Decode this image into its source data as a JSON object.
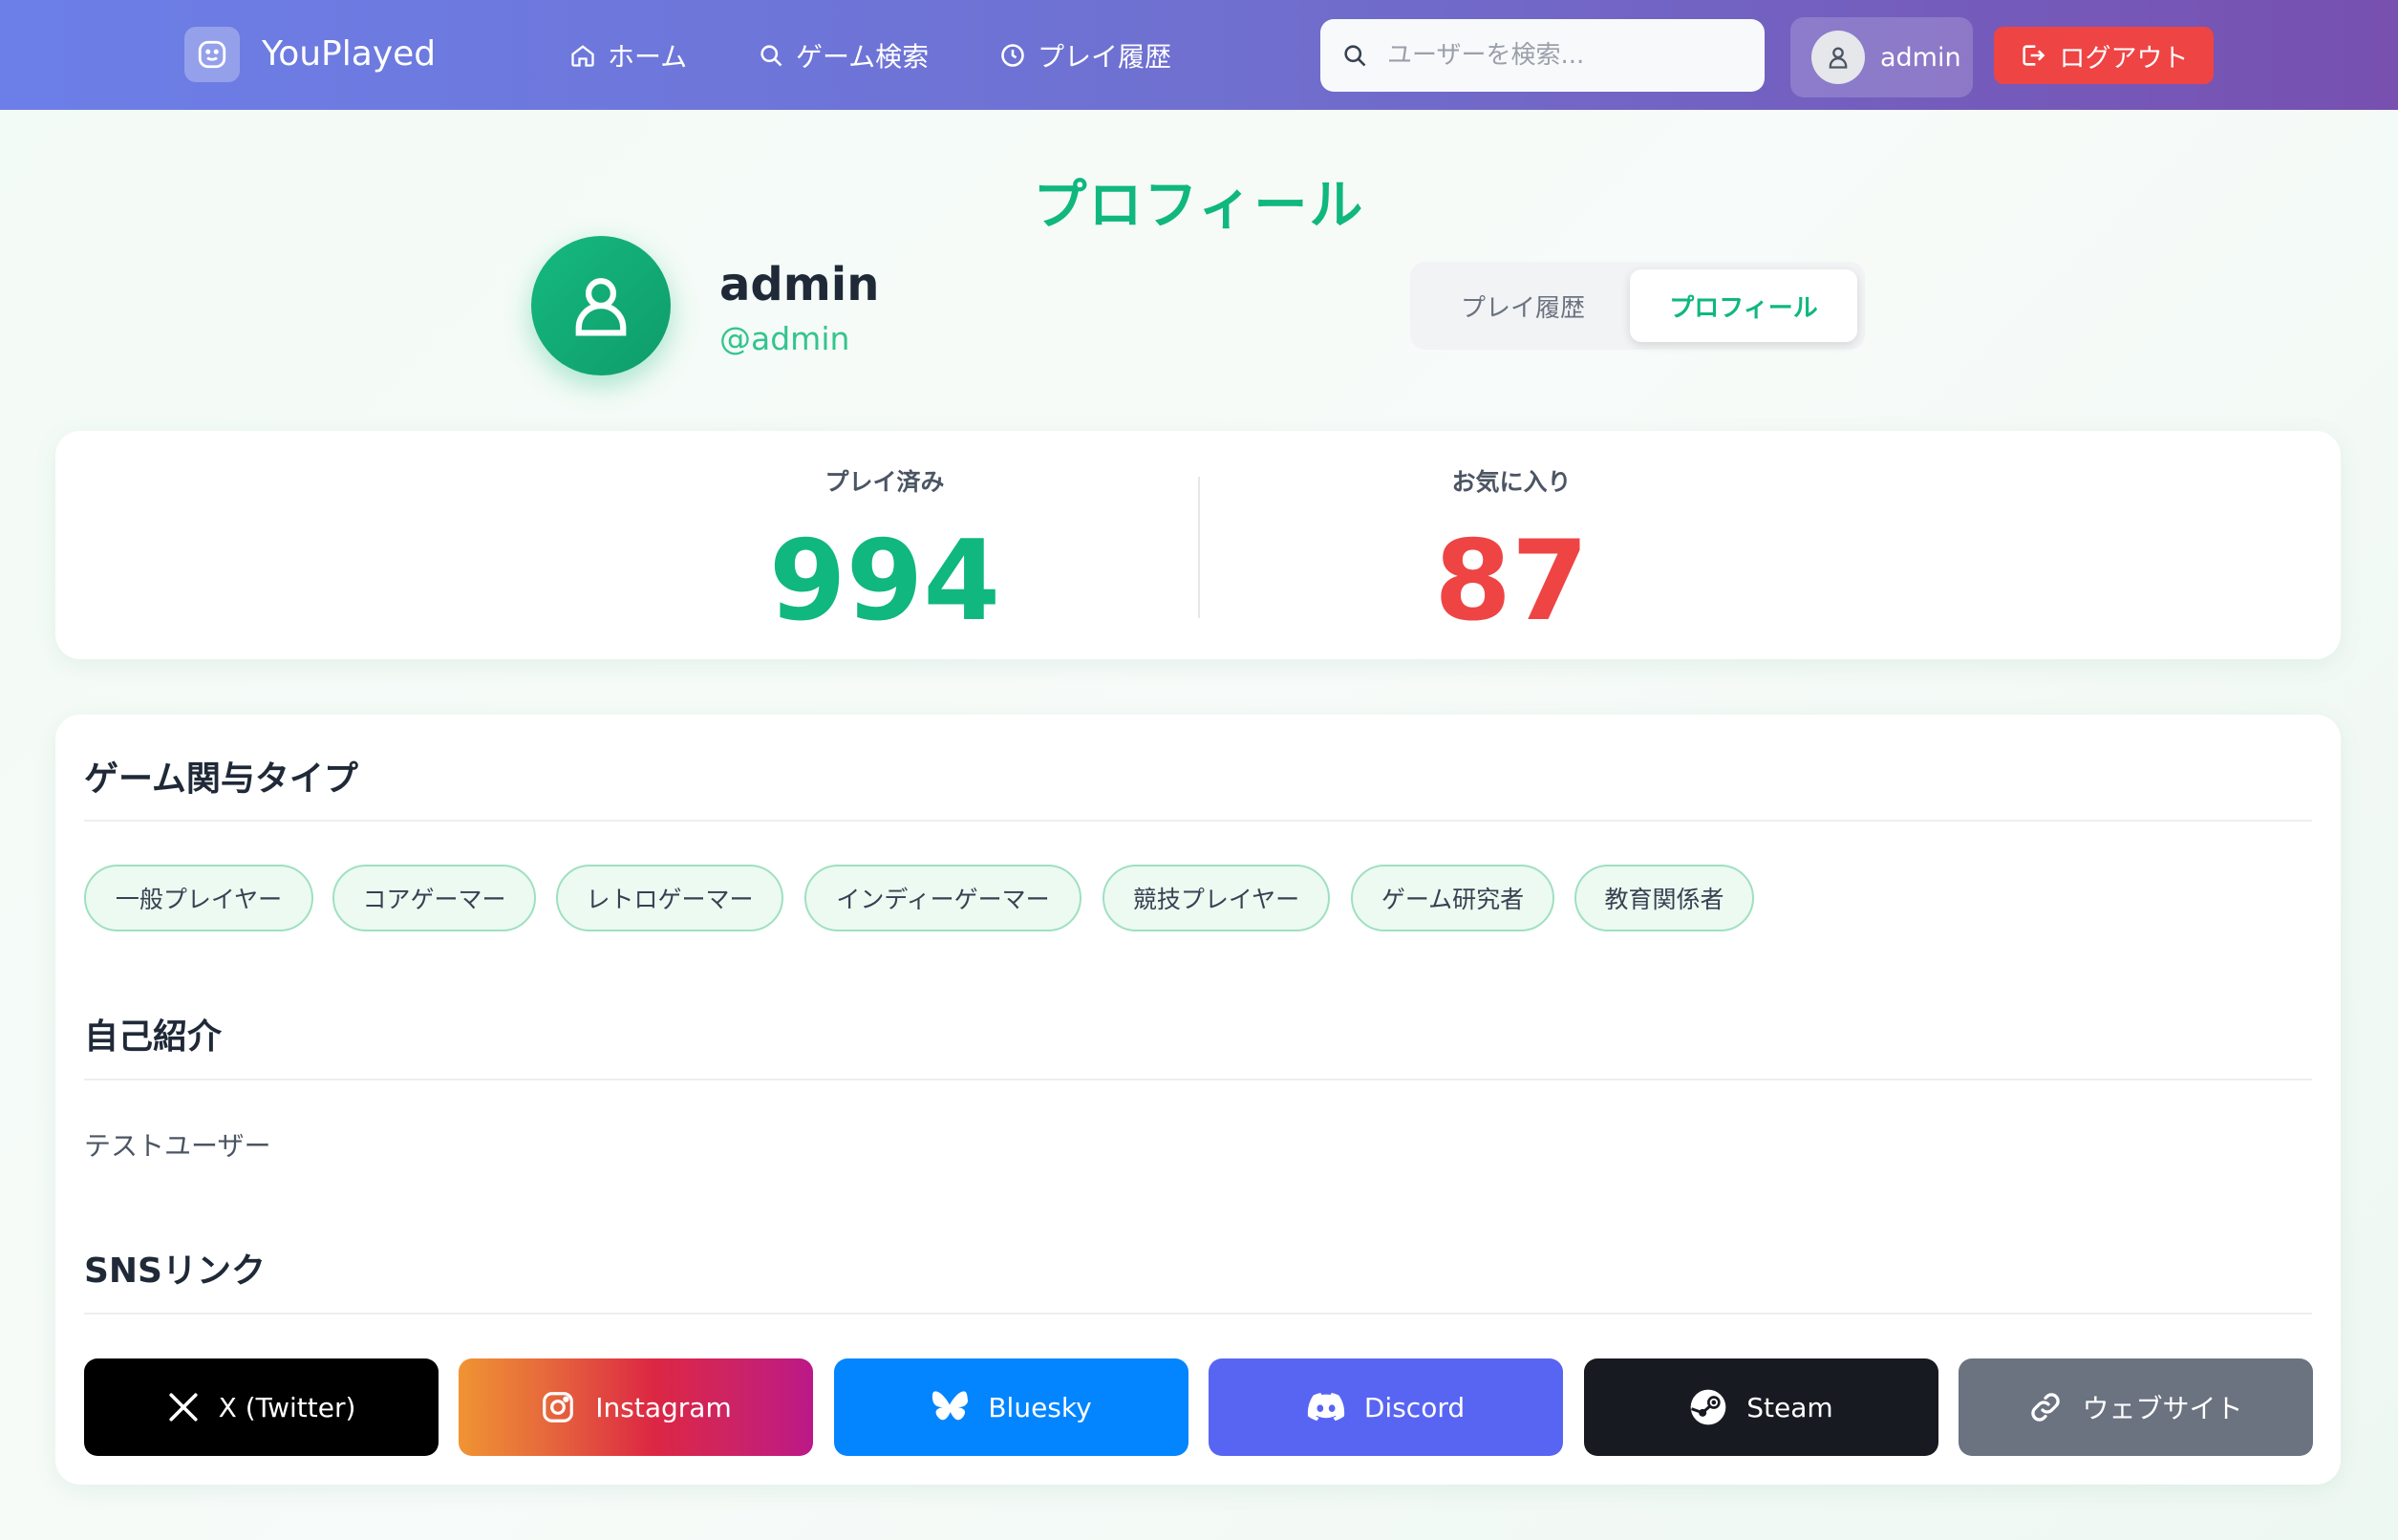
{
  "header": {
    "app_name": "YouPlayed",
    "nav": {
      "home": "ホーム",
      "game_search": "ゲーム検索",
      "play_history": "プレイ履歴"
    },
    "search_placeholder": "ユーザーを検索...",
    "user_name": "admin",
    "logout_label": "ログアウト"
  },
  "profile": {
    "page_title": "プロフィール",
    "display_name": "admin",
    "handle": "@admin",
    "tabs": [
      {
        "label": "プレイ履歴",
        "active": false
      },
      {
        "label": "プロフィール",
        "active": true
      }
    ]
  },
  "stats": {
    "played_label": "プレイ済み",
    "played_value": "994",
    "favorites_label": "お気に入り",
    "favorites_value": "87",
    "played_color": "#10b77f",
    "favorites_color": "#ef4444"
  },
  "engagement": {
    "title": "ゲーム関与タイプ",
    "tags": [
      "一般プレイヤー",
      "コアゲーマー",
      "レトロゲーマー",
      "インディーゲーマー",
      "競技プレイヤー",
      "ゲーム研究者",
      "教育関係者"
    ]
  },
  "bio": {
    "title": "自己紹介",
    "text": "テストユーザー"
  },
  "sns": {
    "title": "SNSリンク",
    "links": [
      {
        "label": "X (Twitter)",
        "icon": "x-icon",
        "color": "#000000"
      },
      {
        "label": "Instagram",
        "icon": "instagram-icon",
        "color": "#e1306c"
      },
      {
        "label": "Bluesky",
        "icon": "bluesky-icon",
        "color": "#0285ff"
      },
      {
        "label": "Discord",
        "icon": "discord-icon",
        "color": "#5865f2"
      },
      {
        "label": "Steam",
        "icon": "steam-icon",
        "color": "#171a21"
      },
      {
        "label": "ウェブサイト",
        "icon": "link-icon",
        "color": "#6b7280"
      }
    ]
  }
}
